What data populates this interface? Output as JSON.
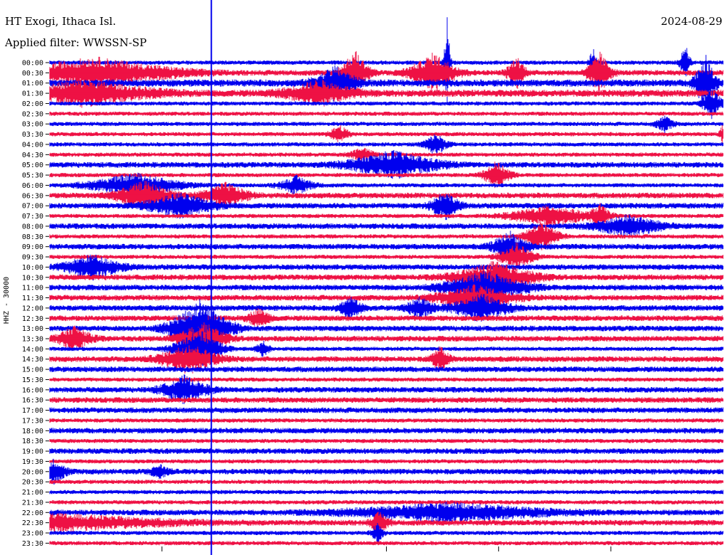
{
  "header": {
    "station": "HT Exogi, Ithaca Isl.",
    "filter": "Applied filter: WWSSN-SP",
    "date": "2024-08-29"
  },
  "chart_data": {
    "type": "line",
    "title": "HT Exogi, Ithaca Isl.",
    "subtitle": "Applied filter: WWSSN-SP",
    "date": "2024-08-29",
    "ylabel": "HHZ - 30000",
    "xlabel": "",
    "trace_colors": [
      "#0000ee",
      "#ee1144"
    ],
    "marker_color": "#0000ee",
    "row_labels": [
      "00:00",
      "00:30",
      "01:00",
      "01:30",
      "02:00",
      "02:30",
      "03:00",
      "03:30",
      "04:00",
      "04:30",
      "05:00",
      "05:30",
      "06:00",
      "06:30",
      "07:00",
      "07:30",
      "08:00",
      "08:30",
      "09:00",
      "09:30",
      "10:00",
      "10:30",
      "11:00",
      "11:30",
      "12:00",
      "12:30",
      "13:00",
      "13:30",
      "14:00",
      "14:30",
      "15:00",
      "15:30",
      "16:00",
      "16:30",
      "17:00",
      "17:30",
      "18:00",
      "18:30",
      "19:00",
      "19:30",
      "20:00",
      "20:30",
      "21:00",
      "21:30",
      "22:00",
      "22:30",
      "23:00",
      "23:30"
    ],
    "row_minutes": 30,
    "x_range_minutes": [
      0,
      30
    ],
    "background_amplitude": [
      3,
      4,
      5,
      5,
      3,
      3,
      3,
      3,
      3,
      3,
      4,
      3,
      3,
      4,
      4,
      3,
      4,
      3,
      4,
      3,
      4,
      4,
      4,
      4,
      4,
      4,
      4,
      4,
      3,
      4,
      4,
      3,
      4,
      4,
      4,
      3,
      4,
      3,
      4,
      3,
      4,
      3,
      3,
      3,
      4,
      4,
      3,
      3
    ],
    "events": [
      {
        "row": 0,
        "minute": 17.7,
        "amplitude": 78,
        "duration": 0.25
      },
      {
        "row": 0,
        "minute": 24.2,
        "amplitude": 22,
        "duration": 0.3
      },
      {
        "row": 0,
        "minute": 28.3,
        "amplitude": 30,
        "duration": 0.4
      },
      {
        "row": 1,
        "minute": 2.0,
        "amplitude": 20,
        "duration": 7.0
      },
      {
        "row": 1,
        "minute": 13.6,
        "amplitude": 30,
        "duration": 1.2
      },
      {
        "row": 1,
        "minute": 17.1,
        "amplitude": 26,
        "duration": 2.0
      },
      {
        "row": 1,
        "minute": 20.8,
        "amplitude": 22,
        "duration": 0.8
      },
      {
        "row": 1,
        "minute": 24.5,
        "amplitude": 28,
        "duration": 1.0
      },
      {
        "row": 2,
        "minute": 12.7,
        "amplitude": 22,
        "duration": 1.8
      },
      {
        "row": 2,
        "minute": 29.2,
        "amplitude": 38,
        "duration": 0.9
      },
      {
        "row": 3,
        "minute": 1.5,
        "amplitude": 16,
        "duration": 6.0
      },
      {
        "row": 3,
        "minute": 12.0,
        "amplitude": 16,
        "duration": 3.0
      },
      {
        "row": 4,
        "minute": 29.5,
        "amplitude": 22,
        "duration": 0.8
      },
      {
        "row": 6,
        "minute": 27.4,
        "amplitude": 10,
        "duration": 0.8
      },
      {
        "row": 7,
        "minute": 12.9,
        "amplitude": 12,
        "duration": 0.8
      },
      {
        "row": 7,
        "minute": 30.0,
        "amplitude": 14,
        "duration": 0.3
      },
      {
        "row": 8,
        "minute": 17.2,
        "amplitude": 14,
        "duration": 1.0
      },
      {
        "row": 9,
        "minute": 13.9,
        "amplitude": 10,
        "duration": 1.0
      },
      {
        "row": 10,
        "minute": 15.3,
        "amplitude": 18,
        "duration": 4.0
      },
      {
        "row": 11,
        "minute": 19.9,
        "amplitude": 18,
        "duration": 1.2
      },
      {
        "row": 12,
        "minute": 3.8,
        "amplitude": 16,
        "duration": 4.0
      },
      {
        "row": 12,
        "minute": 11.0,
        "amplitude": 12,
        "duration": 1.5
      },
      {
        "row": 13,
        "minute": 4.2,
        "amplitude": 18,
        "duration": 2.5
      },
      {
        "row": 13,
        "minute": 7.8,
        "amplitude": 16,
        "duration": 2.0
      },
      {
        "row": 14,
        "minute": 5.8,
        "amplitude": 16,
        "duration": 3.0
      },
      {
        "row": 14,
        "minute": 17.6,
        "amplitude": 20,
        "duration": 1.2
      },
      {
        "row": 15,
        "minute": 22.3,
        "amplitude": 14,
        "duration": 3.5
      },
      {
        "row": 15,
        "minute": 24.5,
        "amplitude": 16,
        "duration": 1.0
      },
      {
        "row": 16,
        "minute": 25.8,
        "amplitude": 14,
        "duration": 3.0
      },
      {
        "row": 17,
        "minute": 21.9,
        "amplitude": 20,
        "duration": 1.5
      },
      {
        "row": 18,
        "minute": 20.5,
        "amplitude": 20,
        "duration": 1.5
      },
      {
        "row": 19,
        "minute": 20.8,
        "amplitude": 18,
        "duration": 1.5
      },
      {
        "row": 20,
        "minute": 1.9,
        "amplitude": 16,
        "duration": 2.5
      },
      {
        "row": 21,
        "minute": 19.8,
        "amplitude": 20,
        "duration": 3.5
      },
      {
        "row": 22,
        "minute": 19.4,
        "amplitude": 22,
        "duration": 3.5
      },
      {
        "row": 23,
        "minute": 19.0,
        "amplitude": 16,
        "duration": 3.5
      },
      {
        "row": 24,
        "minute": 13.4,
        "amplitude": 14,
        "duration": 1.0
      },
      {
        "row": 24,
        "minute": 16.5,
        "amplitude": 14,
        "duration": 1.2
      },
      {
        "row": 24,
        "minute": 19.2,
        "amplitude": 18,
        "duration": 2.5
      },
      {
        "row": 25,
        "minute": 9.3,
        "amplitude": 12,
        "duration": 1.0
      },
      {
        "row": 26,
        "minute": 6.7,
        "amplitude": 40,
        "duration": 2.5
      },
      {
        "row": 27,
        "minute": 1.1,
        "amplitude": 16,
        "duration": 1.5
      },
      {
        "row": 27,
        "minute": 6.8,
        "amplitude": 22,
        "duration": 2.0
      },
      {
        "row": 28,
        "minute": 6.6,
        "amplitude": 28,
        "duration": 2.0
      },
      {
        "row": 28,
        "minute": 9.5,
        "amplitude": 10,
        "duration": 0.6
      },
      {
        "row": 29,
        "minute": 6.2,
        "amplitude": 20,
        "duration": 2.5
      },
      {
        "row": 29,
        "minute": 17.4,
        "amplitude": 16,
        "duration": 0.8
      },
      {
        "row": 32,
        "minute": 6.0,
        "amplitude": 18,
        "duration": 2.0
      },
      {
        "row": 40,
        "minute": 0.2,
        "amplitude": 16,
        "duration": 1.0
      },
      {
        "row": 40,
        "minute": 4.9,
        "amplitude": 8,
        "duration": 0.8
      },
      {
        "row": 44,
        "minute": 17.8,
        "amplitude": 12,
        "duration": 9.0
      },
      {
        "row": 45,
        "minute": 0.5,
        "amplitude": 10,
        "duration": 10.0
      },
      {
        "row": 45,
        "minute": 14.7,
        "amplitude": 14,
        "duration": 0.8
      },
      {
        "row": 46,
        "minute": 14.6,
        "amplitude": 14,
        "duration": 0.5
      }
    ],
    "marker_minute": 7.2,
    "bottom_ticks_minutes": [
      5,
      15,
      20,
      25
    ],
    "grid": false,
    "legend": "none"
  }
}
